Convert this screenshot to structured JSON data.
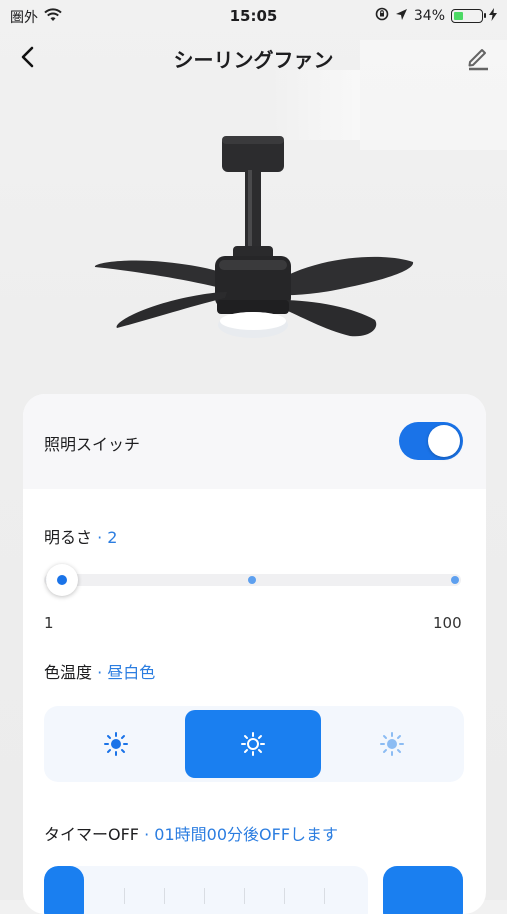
{
  "status_bar": {
    "carrier": "圏外",
    "time": "15:05",
    "battery_percent": "34%",
    "battery_level": 0.34,
    "icons": [
      "wifi-icon",
      "orientation-lock-icon",
      "location-icon",
      "charging-icon"
    ]
  },
  "header": {
    "title": "シーリングファン",
    "back_icon": "chevron-left-icon",
    "edit_icon": "edit-icon"
  },
  "light_switch": {
    "label": "照明スイッチ",
    "on": true
  },
  "brightness": {
    "label": "明るさ",
    "separator": "·",
    "value": "2",
    "min_label": "1",
    "max_label": "100",
    "level": 0.02
  },
  "color_temperature": {
    "label": "色温度",
    "separator": "·",
    "value": "昼白色",
    "options": [
      "warm-sun-icon",
      "neutral-sun-icon",
      "cool-sun-icon"
    ],
    "selected_index": 1
  },
  "timer": {
    "label": "タイマーOFF",
    "separator": "·",
    "value": "01時間00分後OFFします"
  },
  "colors": {
    "accent": "#1a7ff0",
    "accent_text": "#2b7de0",
    "background": "#eeeeee"
  }
}
